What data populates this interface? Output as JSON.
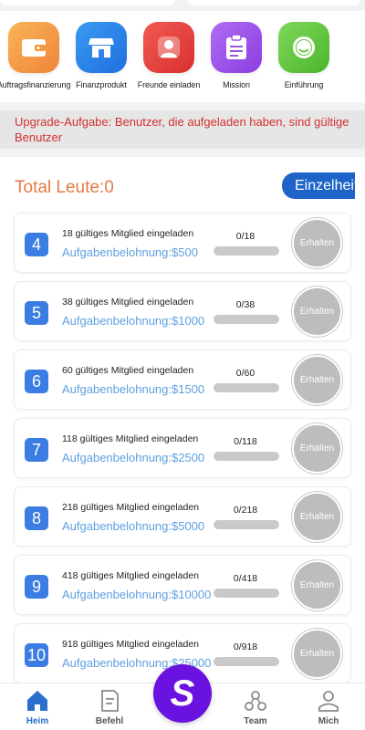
{
  "shortcuts": [
    {
      "label": "Auftragsfinanzierung",
      "icon": "wallet-icon",
      "color": "#f59a3a"
    },
    {
      "label": "Finanzprodukt",
      "icon": "store-icon",
      "color": "#2f86e8"
    },
    {
      "label": "Freunde einladen",
      "icon": "user-icon",
      "color": "#e8403c"
    },
    {
      "label": "Mission",
      "icon": "clipboard-icon",
      "color": "#9a52e6"
    },
    {
      "label": "Einführung",
      "icon": "smile-icon",
      "color": "#62c83c"
    }
  ],
  "notice": "Upgrade-Aufgabe: Benutzer, die aufgeladen haben, sind gültige Benutzer",
  "total": "Total Leute:0",
  "details_label": "Einzelheiten",
  "claim_label": "Erhalten",
  "tasks": [
    {
      "level": "4",
      "desc": "18 gültiges Mitglied eingeladen",
      "reward": "Aufgabenbelohnung:$500",
      "progress": "0/18",
      "fraction": 0
    },
    {
      "level": "5",
      "desc": "38 gültiges Mitglied eingeladen",
      "reward": "Aufgabenbelohnung:$1000",
      "progress": "0/38",
      "fraction": 0
    },
    {
      "level": "6",
      "desc": "60 gültiges Mitglied eingeladen",
      "reward": "Aufgabenbelohnung:$1500",
      "progress": "0/60",
      "fraction": 0
    },
    {
      "level": "7",
      "desc": "118 gültiges Mitglied eingeladen",
      "reward": "Aufgabenbelohnung:$2500",
      "progress": "0/118",
      "fraction": 0
    },
    {
      "level": "8",
      "desc": "218 gültiges Mitglied eingeladen",
      "reward": "Aufgabenbelohnung:$5000",
      "progress": "0/218",
      "fraction": 0
    },
    {
      "level": "9",
      "desc": "418 gültiges Mitglied eingeladen",
      "reward": "Aufgabenbelohnung:$10000",
      "progress": "0/418",
      "fraction": 0
    },
    {
      "level": "10",
      "desc": "918 gültiges Mitglied eingeladen",
      "reward": "Aufgabenbelohnung:$25000",
      "progress": "0/918",
      "fraction": 0
    }
  ],
  "nav": [
    {
      "label": "Heim",
      "icon": "home-icon",
      "active": true
    },
    {
      "label": "Befehl",
      "icon": "document-icon",
      "active": false
    },
    {
      "label": "Team",
      "icon": "team-icon",
      "active": false
    },
    {
      "label": "Mich",
      "icon": "person-icon",
      "active": false
    }
  ],
  "center_button": "S",
  "colors": {
    "accent": "#1e64c8",
    "notice": "#d43030",
    "total": "#e37a45",
    "center": "#6a12e0"
  }
}
